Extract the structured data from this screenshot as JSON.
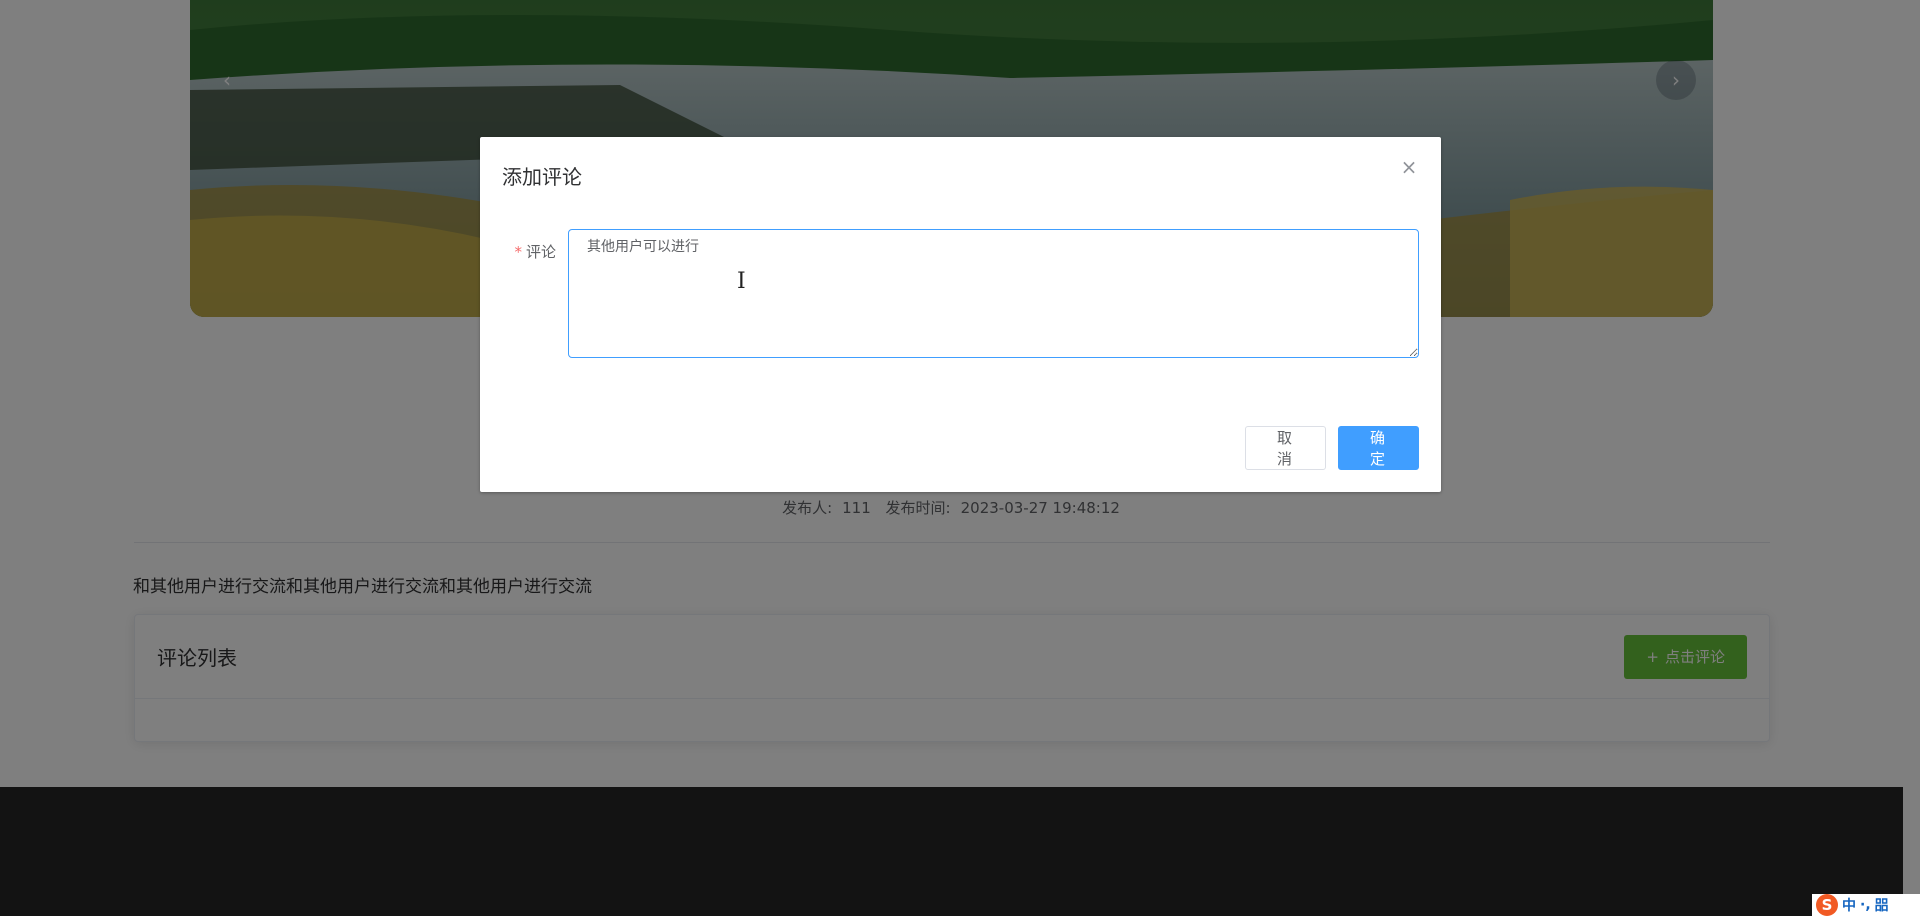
{
  "carousel": {
    "prev_icon": "chevron-left-icon",
    "next_icon": "chevron-right-icon",
    "prev_glyph": "‹",
    "next_glyph": "›"
  },
  "post": {
    "publisher_label": "发布人:",
    "publisher": "111",
    "time_label": "发布时间:",
    "time": "2023-03-27 19:48:12",
    "content": "和其他用户进行交流和其他用户进行交流和其他用户进行交流"
  },
  "comments": {
    "title": "评论列表",
    "add_button": "点击评论",
    "add_icon": "plus-icon"
  },
  "dialog": {
    "title": "添加评论",
    "close_glyph": "×",
    "field_label": "评论",
    "required_mark": "*",
    "textarea_value": "其他用户可以进行",
    "cancel": "取 消",
    "confirm": "确 定"
  },
  "ime": {
    "logo": "S",
    "mode": "中",
    "punct": "·,",
    "extra": "㗊"
  },
  "colors": {
    "primary": "#409eff",
    "success": "#67c23a",
    "footer": "#262626",
    "required": "#f56c6c"
  }
}
